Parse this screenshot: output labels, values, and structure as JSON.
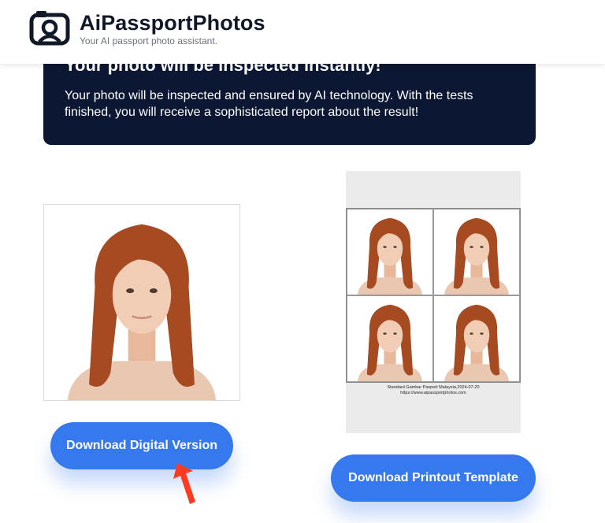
{
  "header": {
    "brand_name": "AiPassportPhotos",
    "tagline": "Your AI passport photo assistant.",
    "logo_icon": "camera-icon"
  },
  "banner": {
    "heading": "Your photo will be inspected instantly!",
    "text": "Your photo will be inspected and ensured by AI technology. With the tests finished, you will receive a sophisticated report about the result!"
  },
  "print_sheet": {
    "caption_line1": "Standard Gambar Pasport Malaysia,2024-07-20",
    "caption_line2": "https://www.aipassportphotos.com"
  },
  "buttons": {
    "download_digital": "Download Digital Version",
    "download_printout": "Download Printout Template"
  },
  "colors": {
    "banner_bg": "#0b1733",
    "button_bg": "#3679ee",
    "annotation_arrow": "#ff3b1f"
  }
}
